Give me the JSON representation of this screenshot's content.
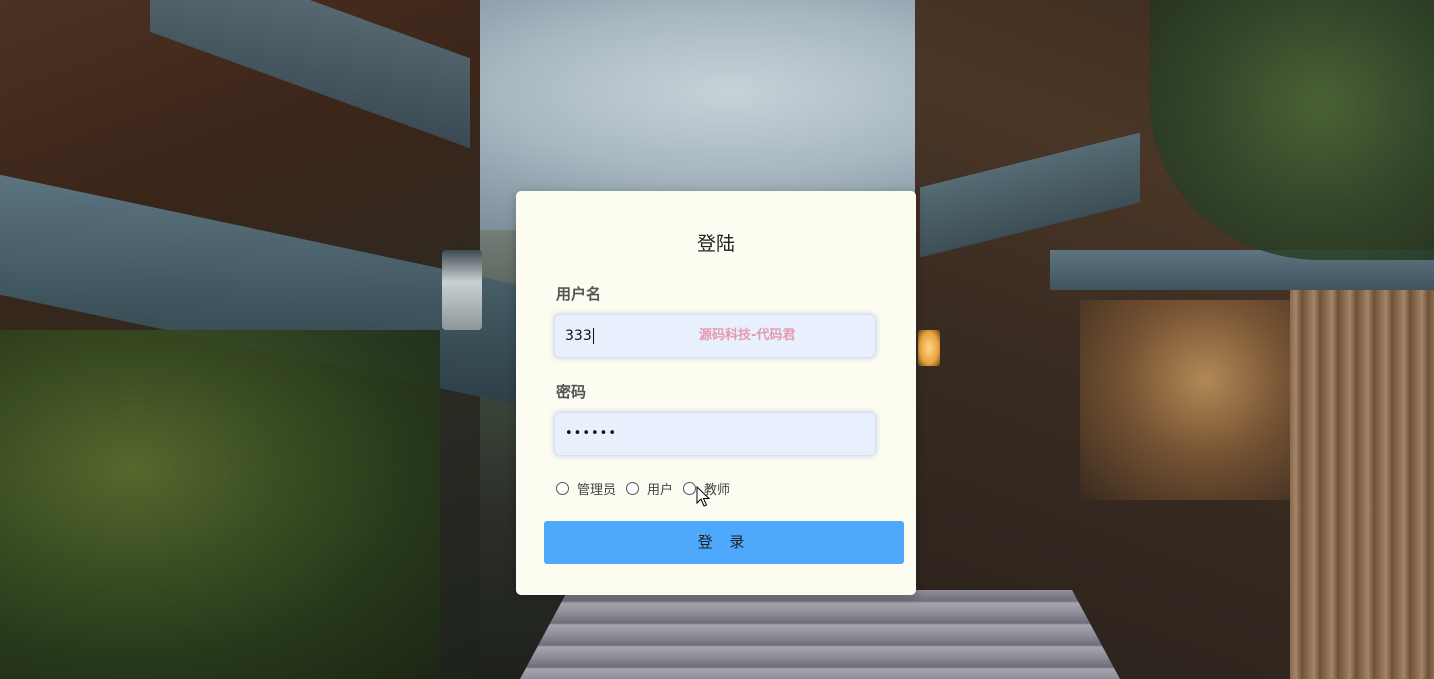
{
  "login": {
    "title": "登陆",
    "username_label": "用户名",
    "username_value": "333",
    "watermark": "源码科技-代码君",
    "password_label": "密码",
    "password_value": "••••••",
    "roles": [
      {
        "label": "管理员",
        "checked": false
      },
      {
        "label": "用户",
        "checked": false
      },
      {
        "label": "教师",
        "checked": false
      }
    ],
    "submit_label": "登 录"
  },
  "colors": {
    "card_bg": "#fdfcf0",
    "input_bg": "#e8f0fe",
    "button_bg": "#4ea8fb",
    "watermark": "#e59ab0"
  },
  "background": {
    "description_icon": "kyoto-street-photo"
  },
  "icons": {
    "cursor": "mouse-pointer-icon"
  }
}
